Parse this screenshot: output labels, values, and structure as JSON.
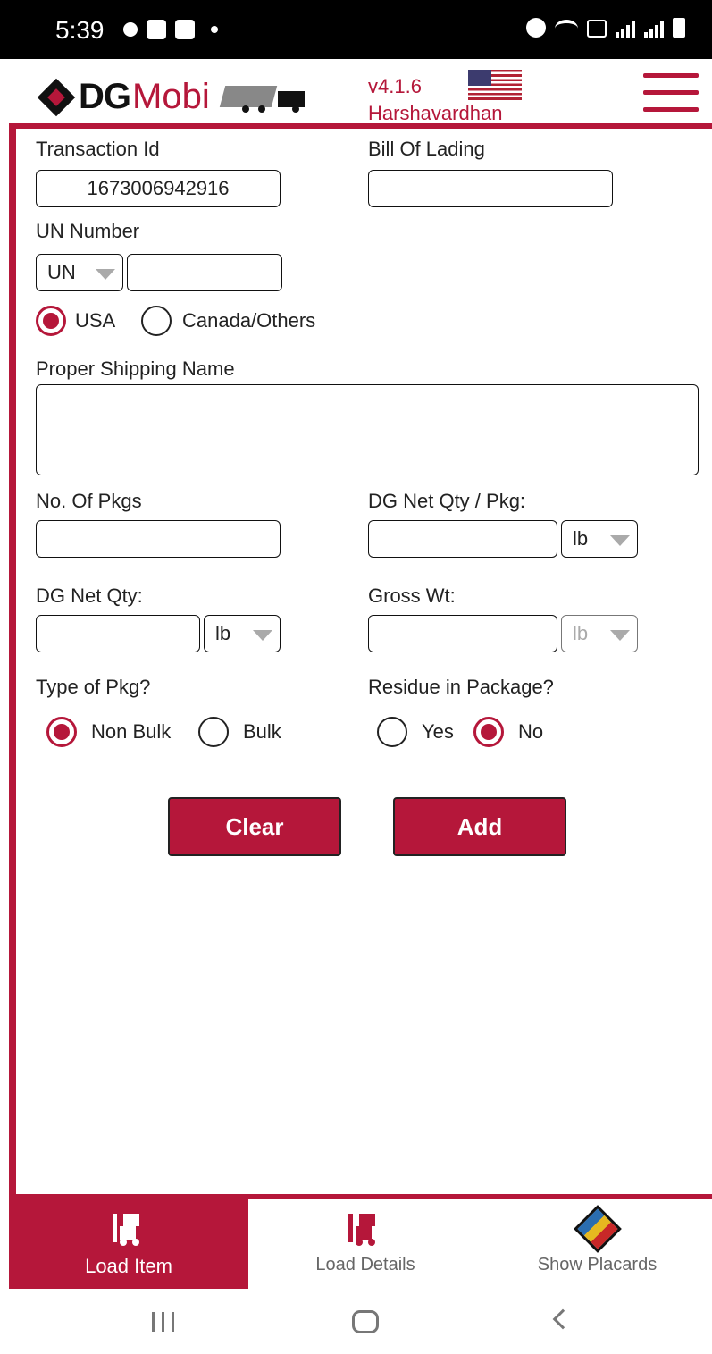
{
  "status_bar": {
    "time": "5:39"
  },
  "header": {
    "logo_dg": "DG",
    "logo_mobi": "Mobi",
    "version": "v4.1.6",
    "username": "Harshavardhan",
    "accent": "#b5173a"
  },
  "form": {
    "transaction_id": {
      "label": "Transaction Id",
      "value": "1673006942916"
    },
    "bill_of_lading": {
      "label": "Bill Of Lading",
      "value": ""
    },
    "un_number": {
      "label": "UN Number",
      "prefix": "UN",
      "value": ""
    },
    "region": {
      "usa": "USA",
      "canada": "Canada/Others",
      "selected": "usa"
    },
    "proper_shipping_name": {
      "label": "Proper Shipping Name",
      "value": ""
    },
    "no_of_pkgs": {
      "label": "No. Of Pkgs",
      "value": ""
    },
    "dg_net_qty_per_pkg": {
      "label": "DG Net Qty / Pkg:",
      "value": "",
      "unit": "lb"
    },
    "dg_net_qty": {
      "label": "DG Net Qty:",
      "value": "",
      "unit": "lb"
    },
    "gross_wt": {
      "label": "Gross Wt:",
      "value": "",
      "unit": "lb"
    },
    "type_of_pkg": {
      "label": "Type of Pkg?",
      "non_bulk": "Non Bulk",
      "bulk": "Bulk",
      "selected": "non_bulk"
    },
    "residue": {
      "label": "Residue in Package?",
      "yes": "Yes",
      "no": "No",
      "selected": "no"
    }
  },
  "buttons": {
    "clear": "Clear",
    "add": "Add"
  },
  "tabs": [
    {
      "label": "Load Item",
      "icon": "forklift-icon",
      "active": true
    },
    {
      "label": "Load Details",
      "icon": "forklift-icon",
      "active": false
    },
    {
      "label": "Show Placards",
      "icon": "placard-icon",
      "active": false
    }
  ]
}
